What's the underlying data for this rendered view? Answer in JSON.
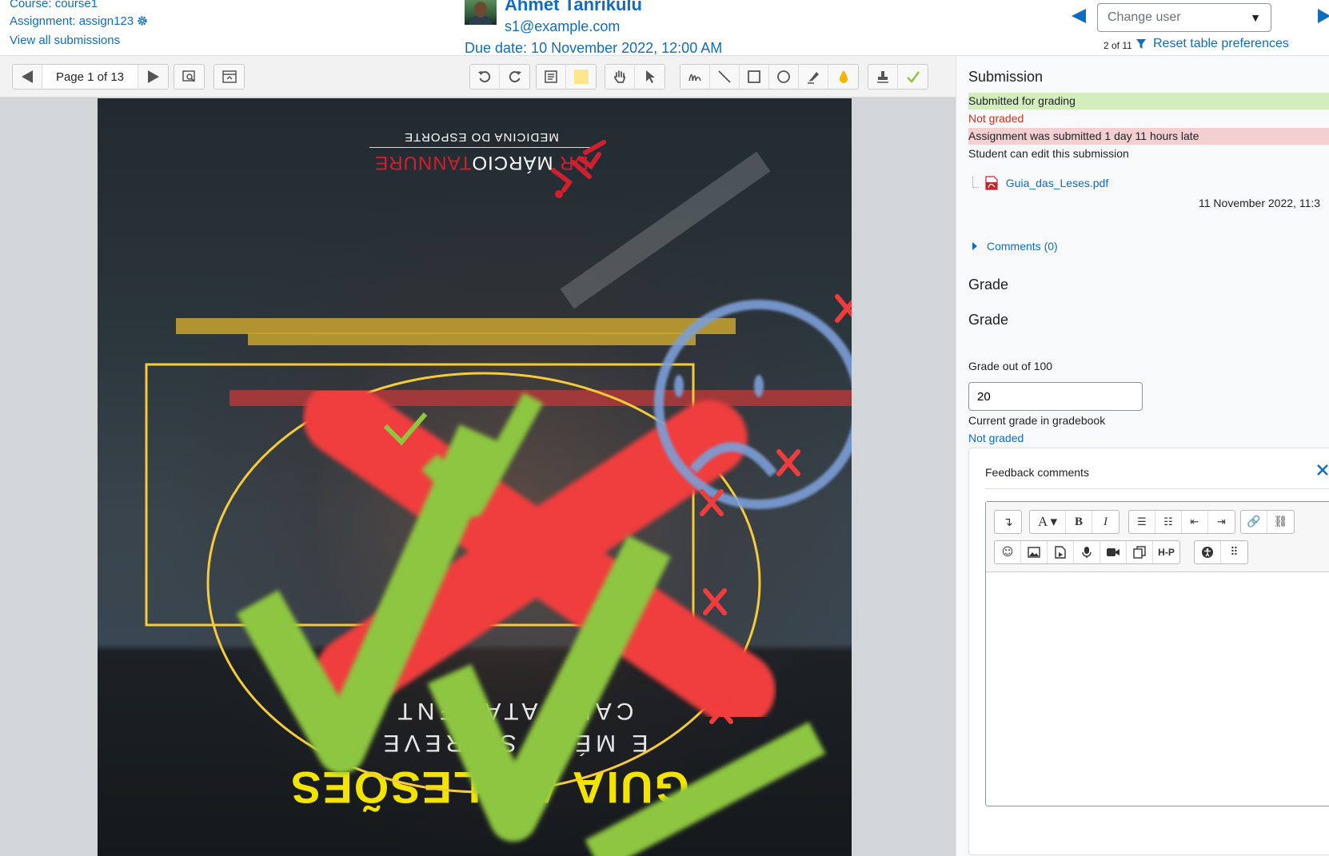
{
  "header": {
    "course": "Course: course1",
    "assignment": "Assignment: assign123",
    "view_all": "View all submissions",
    "user_name": "Ahmet Tanrikulu",
    "user_email": "s1@example.com",
    "due_date": "Due date: 10 November 2022, 12:00 AM",
    "change_user_placeholder": "Change user",
    "user_count": "2 of 11",
    "reset_link": "Reset table preferences"
  },
  "toolbar": {
    "page_label": "Page 1 of 13"
  },
  "document": {
    "logo_line1_red1": "DR",
    "logo_line1_white": "MÁRCIO",
    "logo_line1_red2": "TANNURE",
    "logo_line2": "MEDICINA DO ESPORTE",
    "sub_line1": "E MÉTO  S    PREVE",
    "sub_line2": "CAUS    ATAMENT",
    "title": "GUIA  AS LESÕES"
  },
  "panel": {
    "submission_title": "Submission",
    "status_submitted": "Submitted for grading",
    "status_not_graded": "Not graded",
    "status_late": "Assignment was submitted 1 day 11 hours late",
    "status_edit": "Student can edit this submission",
    "file_name": "Guia_das_Leses.pdf",
    "file_date": "11 November 2022, 11:3",
    "comments": "Comments (0)",
    "grade_heading": "Grade",
    "grade_subheading": "Grade",
    "grade_out_of": "Grade out of 100",
    "grade_value": "20",
    "current_grade_label": "Current grade in gradebook",
    "current_grade_value": "Not graded",
    "feedback_title": "Feedback comments"
  },
  "colors": {
    "link": "#0f6cbf",
    "status_ok_bg": "#d4edbc",
    "status_late_bg": "#f3cfd2",
    "status_error": "#ca3120",
    "annotation_red": "#f03c3c",
    "annotation_green": "#8dc63f",
    "annotation_yellow": "#f5cc38",
    "annotation_blue": "#7c9fd8"
  }
}
